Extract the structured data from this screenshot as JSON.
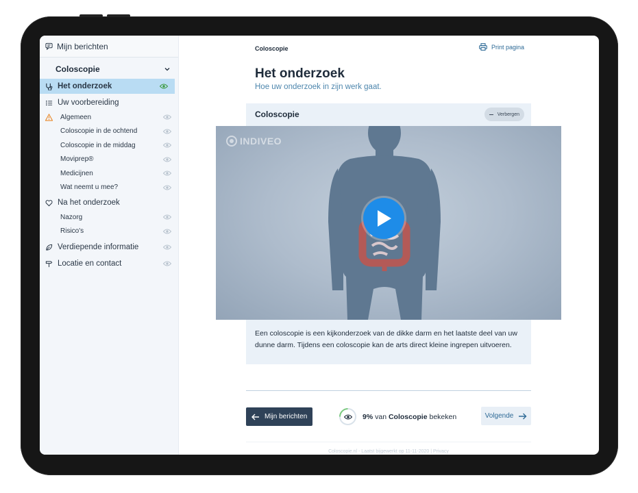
{
  "sidebar": {
    "top_label": "Mijn berichten",
    "section_title": "Coloscopie",
    "items": [
      {
        "label": "Het onderzoek",
        "active": true
      },
      {
        "label": "Uw voorbereiding"
      },
      {
        "label": "Algemeen"
      },
      {
        "label": "Coloscopie in de ochtend"
      },
      {
        "label": "Coloscopie in de middag"
      },
      {
        "label": "Moviprep®"
      },
      {
        "label": "Medicijnen"
      },
      {
        "label": "Wat neemt u mee?"
      },
      {
        "label": "Na het onderzoek"
      },
      {
        "label": "Nazorg"
      },
      {
        "label": "Risico's"
      },
      {
        "label": "Verdiepende informatie"
      },
      {
        "label": "Locatie en contact"
      }
    ]
  },
  "header": {
    "breadcrumb": "Coloscopie",
    "print_label": "Print pagina",
    "title": "Het onderzoek",
    "subtitle": "Hoe uw onderzoek in zijn werk gaat."
  },
  "card": {
    "title": "Coloscopie",
    "hide_label": "Verbergen",
    "text": "Een coloscopie is een kijkonderzoek van de dikke darm en het laatste deel van uw dunne darm. Tijdens een coloscopie kan de arts direct kleine ingrepen uitvoeren."
  },
  "video": {
    "brand": "INDIVEO"
  },
  "nav": {
    "prev_label": "Mijn berichten",
    "progress_percent": "9%",
    "progress_of": "van",
    "progress_subject": "Coloscopie",
    "progress_suffix": "bekeken",
    "next_label": "Volgende"
  },
  "footer": {
    "text": "Coloscopie.nl - Laatst bijgewerkt op 11-11-2020 | Privacy"
  },
  "colors": {
    "accent": "#1e8ce8",
    "active_bg": "#b9dcf3",
    "dark_button": "#2f4258",
    "progress_ring": "#7ccb7f"
  }
}
